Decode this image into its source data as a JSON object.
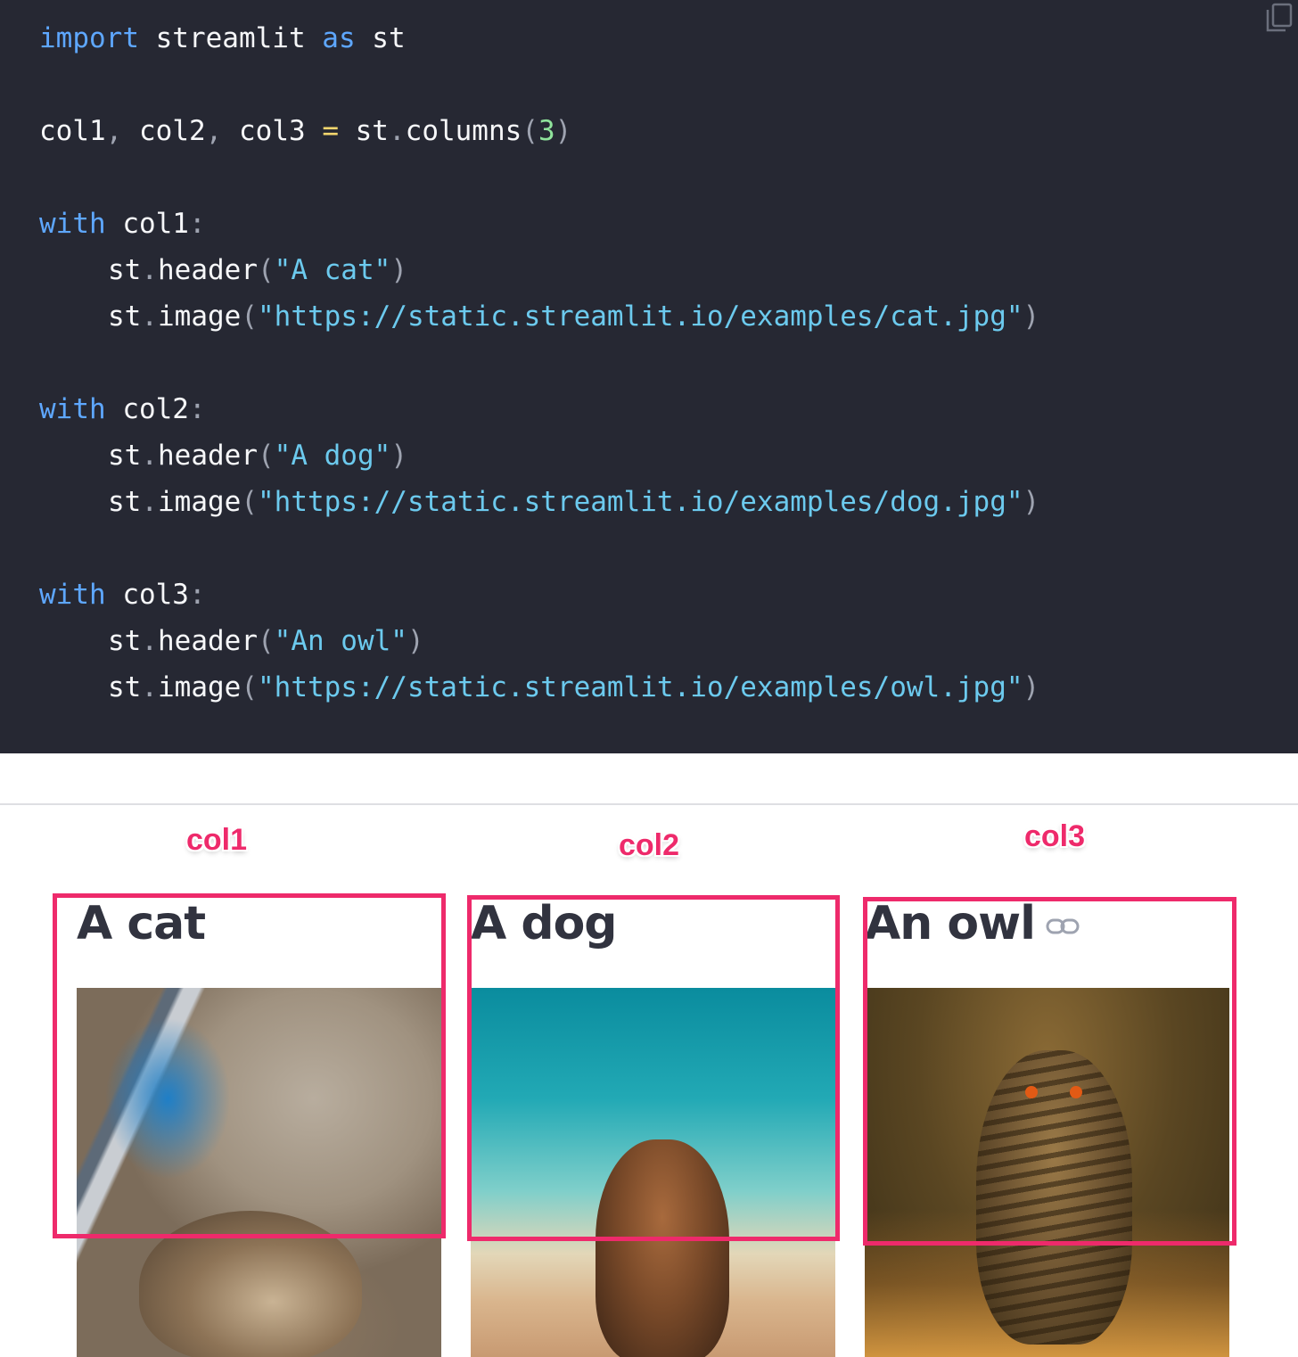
{
  "code": {
    "lines": [
      [
        {
          "t": "import",
          "c": "kw"
        },
        {
          "t": " streamlit ",
          "c": ""
        },
        {
          "t": "as",
          "c": "kw"
        },
        {
          "t": " st",
          "c": ""
        }
      ],
      [],
      [
        {
          "t": "col1",
          "c": ""
        },
        {
          "t": ",",
          "c": "punc"
        },
        {
          "t": " col2",
          "c": ""
        },
        {
          "t": ",",
          "c": "punc"
        },
        {
          "t": " col3 ",
          "c": ""
        },
        {
          "t": "=",
          "c": "eq"
        },
        {
          "t": " st",
          "c": ""
        },
        {
          "t": ".",
          "c": "punc"
        },
        {
          "t": "columns",
          "c": ""
        },
        {
          "t": "(",
          "c": "punc"
        },
        {
          "t": "3",
          "c": "num"
        },
        {
          "t": ")",
          "c": "punc"
        }
      ],
      [],
      [
        {
          "t": "with",
          "c": "kw"
        },
        {
          "t": " col1",
          "c": ""
        },
        {
          "t": ":",
          "c": "punc"
        }
      ],
      [
        {
          "t": "st",
          "c": ""
        },
        {
          "t": ".",
          "c": "punc"
        },
        {
          "t": "header",
          "c": ""
        },
        {
          "t": "(",
          "c": "punc"
        },
        {
          "t": "\"A cat\"",
          "c": "str"
        },
        {
          "t": ")",
          "c": "punc"
        }
      ],
      [
        {
          "t": "st",
          "c": ""
        },
        {
          "t": ".",
          "c": "punc"
        },
        {
          "t": "image",
          "c": ""
        },
        {
          "t": "(",
          "c": "punc"
        },
        {
          "t": "\"https://static.streamlit.io/examples/cat.jpg\"",
          "c": "str"
        },
        {
          "t": ")",
          "c": "punc"
        }
      ],
      [],
      [
        {
          "t": "with",
          "c": "kw"
        },
        {
          "t": " col2",
          "c": ""
        },
        {
          "t": ":",
          "c": "punc"
        }
      ],
      [
        {
          "t": "st",
          "c": ""
        },
        {
          "t": ".",
          "c": "punc"
        },
        {
          "t": "header",
          "c": ""
        },
        {
          "t": "(",
          "c": "punc"
        },
        {
          "t": "\"A dog\"",
          "c": "str"
        },
        {
          "t": ")",
          "c": "punc"
        }
      ],
      [
        {
          "t": "st",
          "c": ""
        },
        {
          "t": ".",
          "c": "punc"
        },
        {
          "t": "image",
          "c": ""
        },
        {
          "t": "(",
          "c": "punc"
        },
        {
          "t": "\"https://static.streamlit.io/examples/dog.jpg\"",
          "c": "str"
        },
        {
          "t": ")",
          "c": "punc"
        }
      ],
      [],
      [
        {
          "t": "with",
          "c": "kw"
        },
        {
          "t": " col3",
          "c": ""
        },
        {
          "t": ":",
          "c": "punc"
        }
      ],
      [
        {
          "t": "st",
          "c": ""
        },
        {
          "t": ".",
          "c": "punc"
        },
        {
          "t": "header",
          "c": ""
        },
        {
          "t": "(",
          "c": "punc"
        },
        {
          "t": "\"An owl\"",
          "c": "str"
        },
        {
          "t": ")",
          "c": "punc"
        }
      ],
      [
        {
          "t": "st",
          "c": ""
        },
        {
          "t": ".",
          "c": "punc"
        },
        {
          "t": "image",
          "c": ""
        },
        {
          "t": "(",
          "c": "punc"
        },
        {
          "t": "\"https://static.streamlit.io/examples/owl.jpg\"",
          "c": "str"
        },
        {
          "t": ")",
          "c": "punc"
        }
      ]
    ],
    "copy_icon": "copy-icon"
  },
  "annotations": {
    "col1": "col1",
    "col2": "col2",
    "col3": "col3",
    "color": "#ee2a6b"
  },
  "columns": [
    {
      "header": "A cat",
      "image": "cat-photo"
    },
    {
      "header": "A dog",
      "image": "dog-photo"
    },
    {
      "header": "An owl",
      "image": "owl-photo",
      "icon": "link-icon"
    }
  ],
  "colors": {
    "code_bg": "#262833",
    "keyword": "#5ea7ff",
    "string": "#6ccaee",
    "number": "#8fe39b",
    "header_text": "#31333f"
  }
}
